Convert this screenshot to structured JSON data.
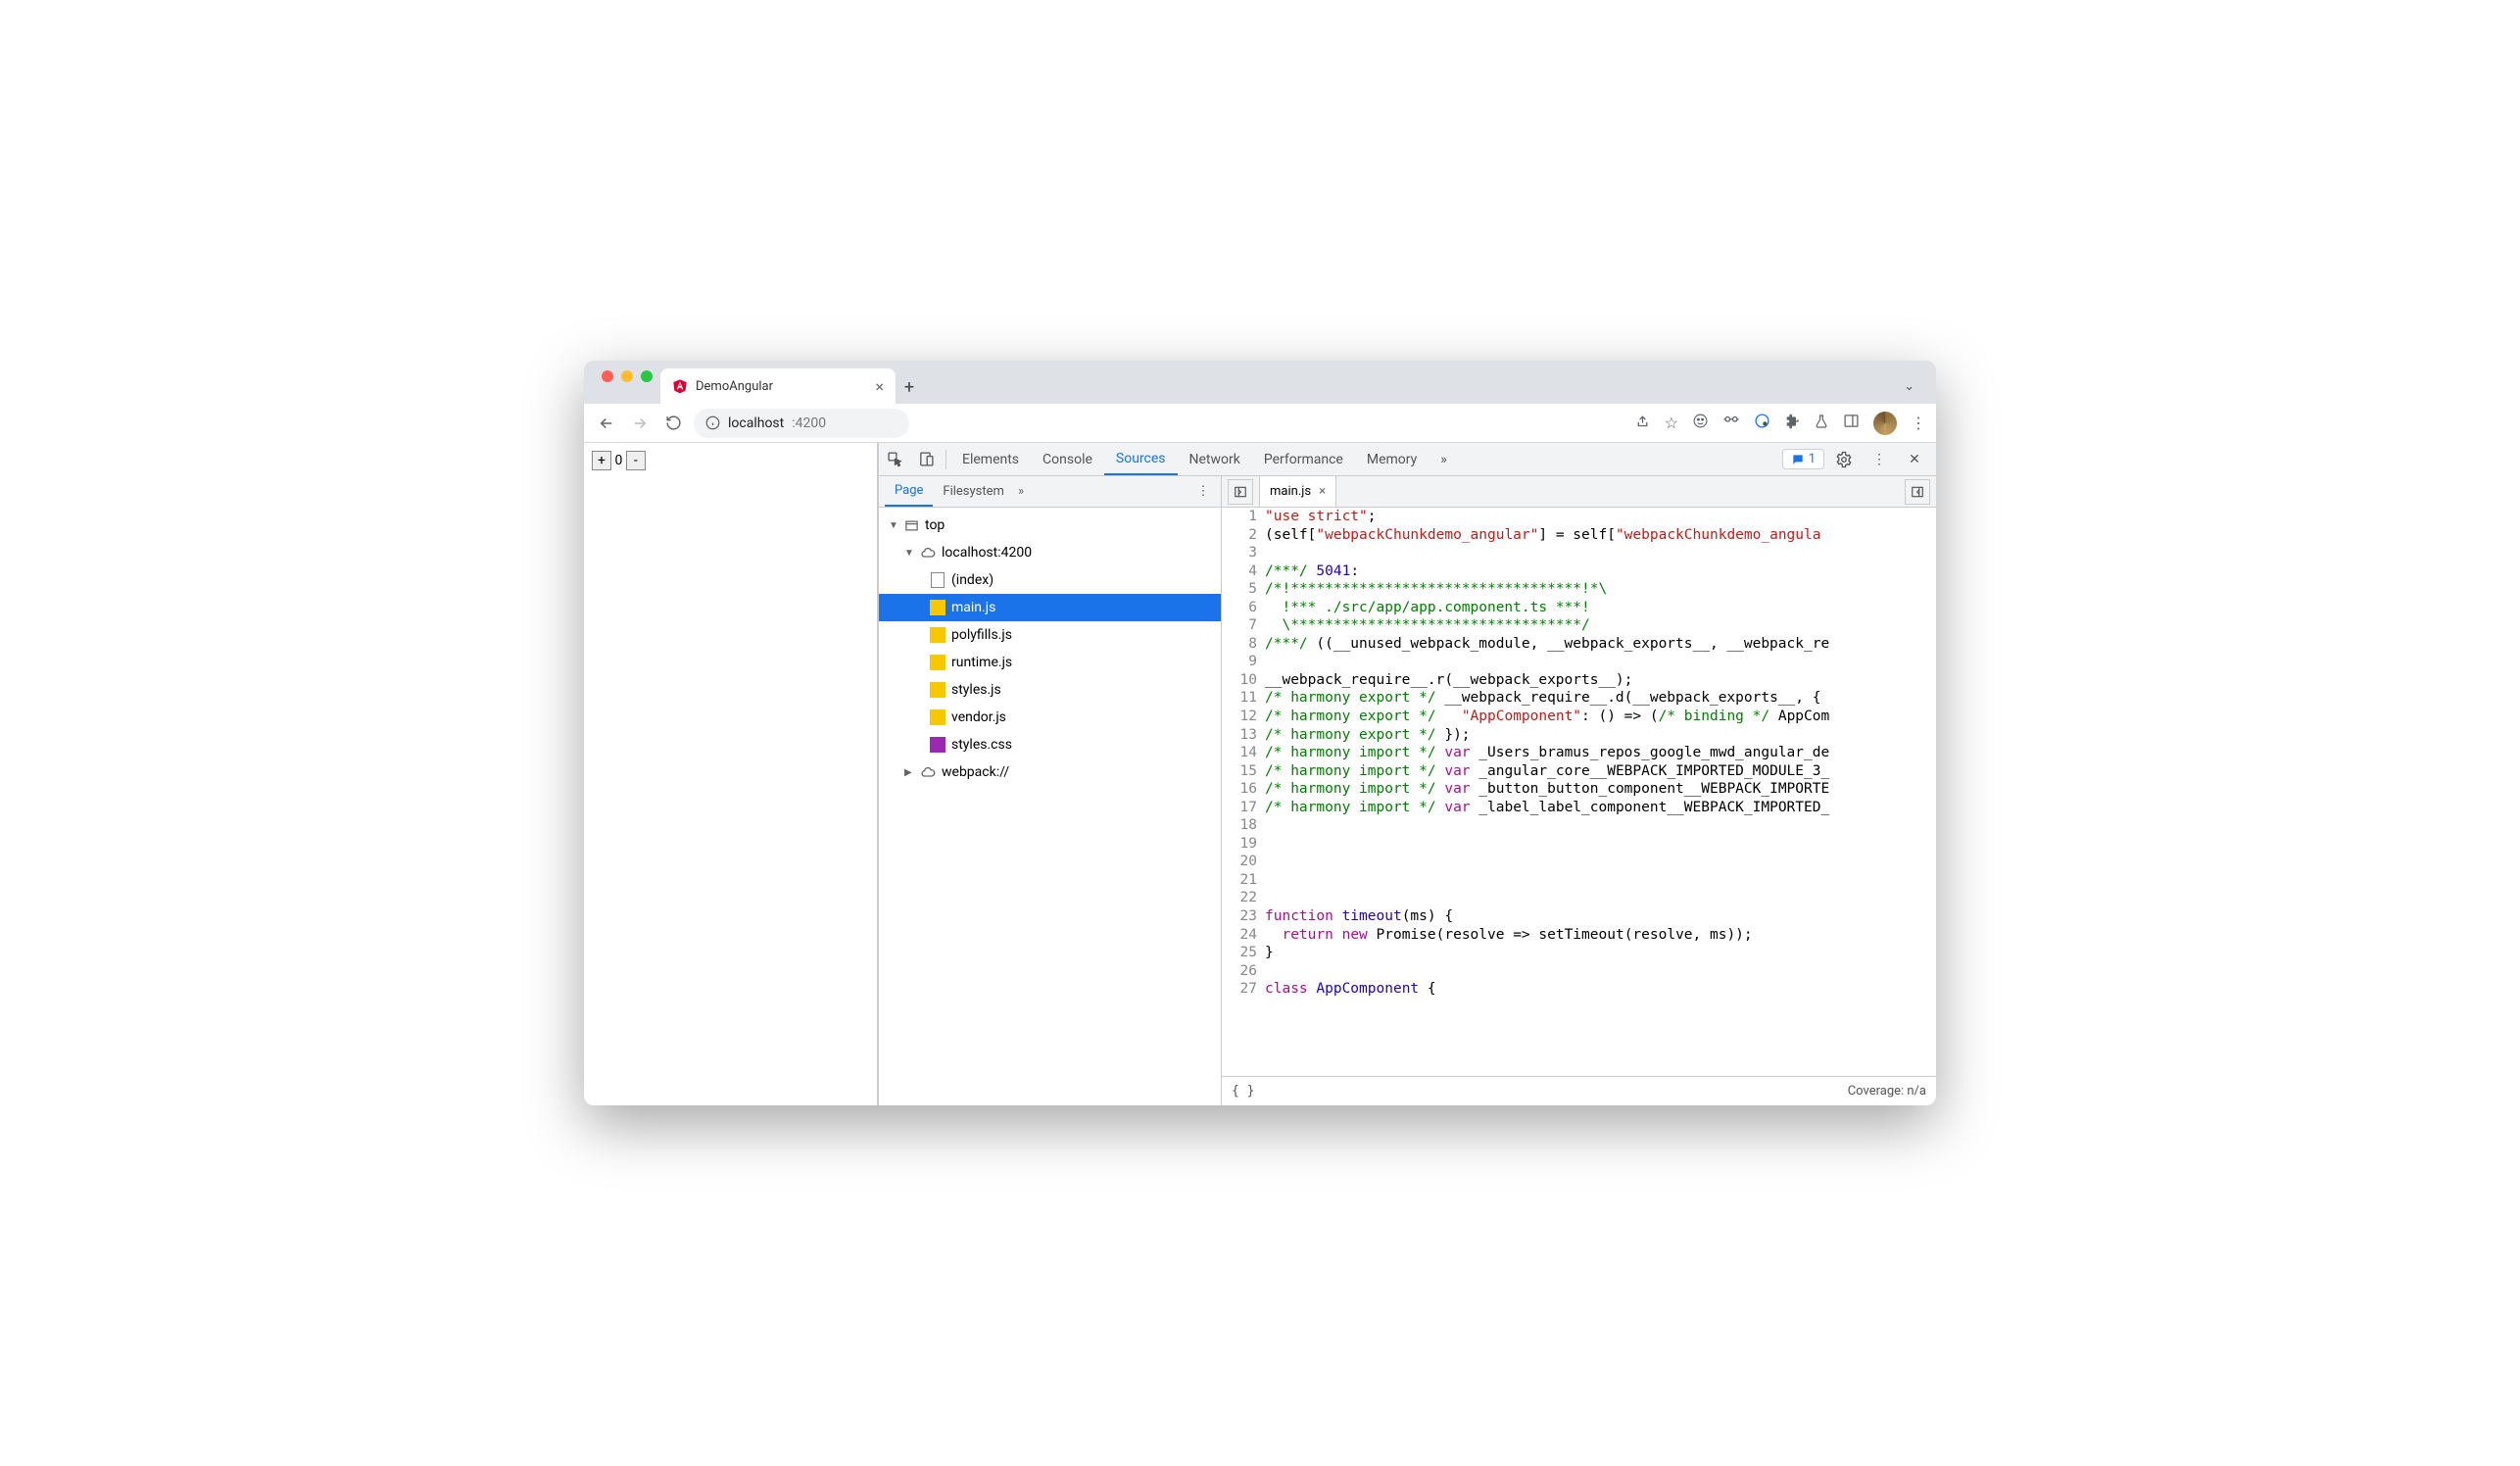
{
  "browser": {
    "tab_title": "DemoAngular",
    "url_host": "localhost",
    "url_port": ":4200"
  },
  "page": {
    "counter": "0"
  },
  "devtools": {
    "tabs": [
      "Elements",
      "Console",
      "Sources",
      "Network",
      "Performance",
      "Memory"
    ],
    "active_tab": "Sources",
    "issues_count": "1",
    "nav_tabs": [
      "Page",
      "Filesystem"
    ],
    "tree": {
      "top": "top",
      "host": "localhost:4200",
      "files": [
        "(index)",
        "main.js",
        "polyfills.js",
        "runtime.js",
        "styles.js",
        "vendor.js",
        "styles.css"
      ],
      "selected": "main.js",
      "webpack": "webpack://"
    },
    "editor": {
      "open_file": "main.js",
      "pretty": "{ }",
      "coverage": "Coverage: n/a",
      "lines": [
        {
          "n": 1,
          "html": "<span class='str'>\"use strict\"</span>;"
        },
        {
          "n": 2,
          "html": "(self[<span class='str'>\"webpackChunkdemo_angular\"</span>] = self[<span class='str'>\"webpackChunkdemo_angula</span>"
        },
        {
          "n": 3,
          "html": ""
        },
        {
          "n": 4,
          "html": "<span class='com'>/***/</span> <span class='num'>5041</span>:"
        },
        {
          "n": 5,
          "html": "<span class='com'>/*!**********************************!*\\</span>"
        },
        {
          "n": 6,
          "html": "<span class='com'>  !*** ./src/app/app.component.ts ***!</span>"
        },
        {
          "n": 7,
          "html": "<span class='com'>  \\**********************************/</span>"
        },
        {
          "n": 8,
          "html": "<span class='com'>/***/</span> ((__unused_webpack_module, __webpack_exports__, __webpack_re"
        },
        {
          "n": 9,
          "html": ""
        },
        {
          "n": 10,
          "html": "__webpack_require__.r(__webpack_exports__);"
        },
        {
          "n": 11,
          "html": "<span class='com'>/* harmony export */</span> __webpack_require__.d(__webpack_exports__, {"
        },
        {
          "n": 12,
          "html": "<span class='com'>/* harmony export */</span>   <span class='str'>\"AppComponent\"</span>: () =&gt; (<span class='com'>/* binding */</span> AppCom"
        },
        {
          "n": 13,
          "html": "<span class='com'>/* harmony export */</span> });"
        },
        {
          "n": 14,
          "html": "<span class='com'>/* harmony import */</span> <span class='kw'>var</span> _Users_bramus_repos_google_mwd_angular_de"
        },
        {
          "n": 15,
          "html": "<span class='com'>/* harmony import */</span> <span class='kw'>var</span> _angular_core__WEBPACK_IMPORTED_MODULE_3_"
        },
        {
          "n": 16,
          "html": "<span class='com'>/* harmony import */</span> <span class='kw'>var</span> _button_button_component__WEBPACK_IMPORTE"
        },
        {
          "n": 17,
          "html": "<span class='com'>/* harmony import */</span> <span class='kw'>var</span> _label_label_component__WEBPACK_IMPORTED_"
        },
        {
          "n": 18,
          "html": ""
        },
        {
          "n": 19,
          "html": ""
        },
        {
          "n": 20,
          "html": ""
        },
        {
          "n": 21,
          "html": ""
        },
        {
          "n": 22,
          "html": ""
        },
        {
          "n": 23,
          "html": "<span class='kw'>function</span> <span class='fn'>timeout</span>(ms) {"
        },
        {
          "n": 24,
          "html": "  <span class='kw'>return</span> <span class='kw'>new</span> Promise(resolve =&gt; setTimeout(resolve, ms));"
        },
        {
          "n": 25,
          "html": "}"
        },
        {
          "n": 26,
          "html": ""
        },
        {
          "n": 27,
          "html": "<span class='kw'>class</span> <span class='fn'>AppComponent</span> {"
        }
      ]
    }
  }
}
